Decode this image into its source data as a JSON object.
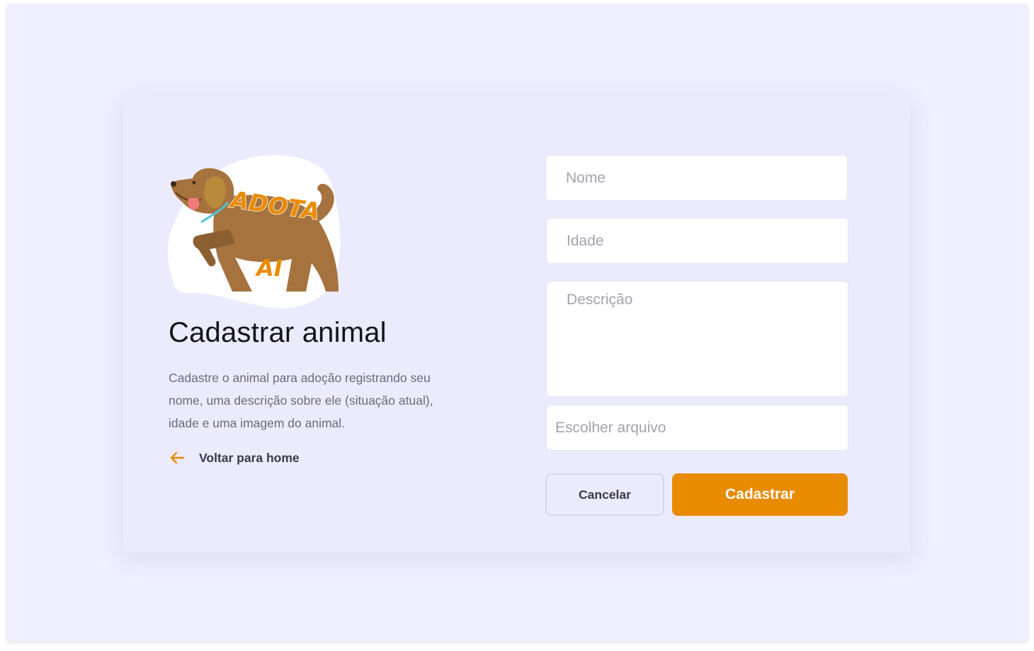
{
  "brand": {
    "logo_word_top": "ADOTA",
    "logo_word_bottom": "AI",
    "logo_icon": "dog-logo-icon",
    "dog_color": "#a6733f",
    "text_color": "#e88b00",
    "collar_color": "#4fc3d6"
  },
  "intro": {
    "title": "Cadastrar animal",
    "description": "Cadastre o animal para adoção registrando seu nome, uma descrição sobre ele (situação atual), idade e uma imagem do animal.",
    "back_link": {
      "icon": "arrow-left-icon",
      "label": "Voltar para home"
    }
  },
  "form": {
    "name_placeholder": "Nome",
    "age_placeholder": "Idade",
    "description_placeholder": "Descrição",
    "file_label": "Escolher arquivo",
    "cancel_label": "Cancelar",
    "submit_label": "Cadastrar"
  },
  "colors": {
    "accent": "#e88b00",
    "background": "#f0efff",
    "card": "#ecebfe",
    "field": "#ffffff",
    "title": "#13131a",
    "body_text": "#6b6b7b"
  }
}
